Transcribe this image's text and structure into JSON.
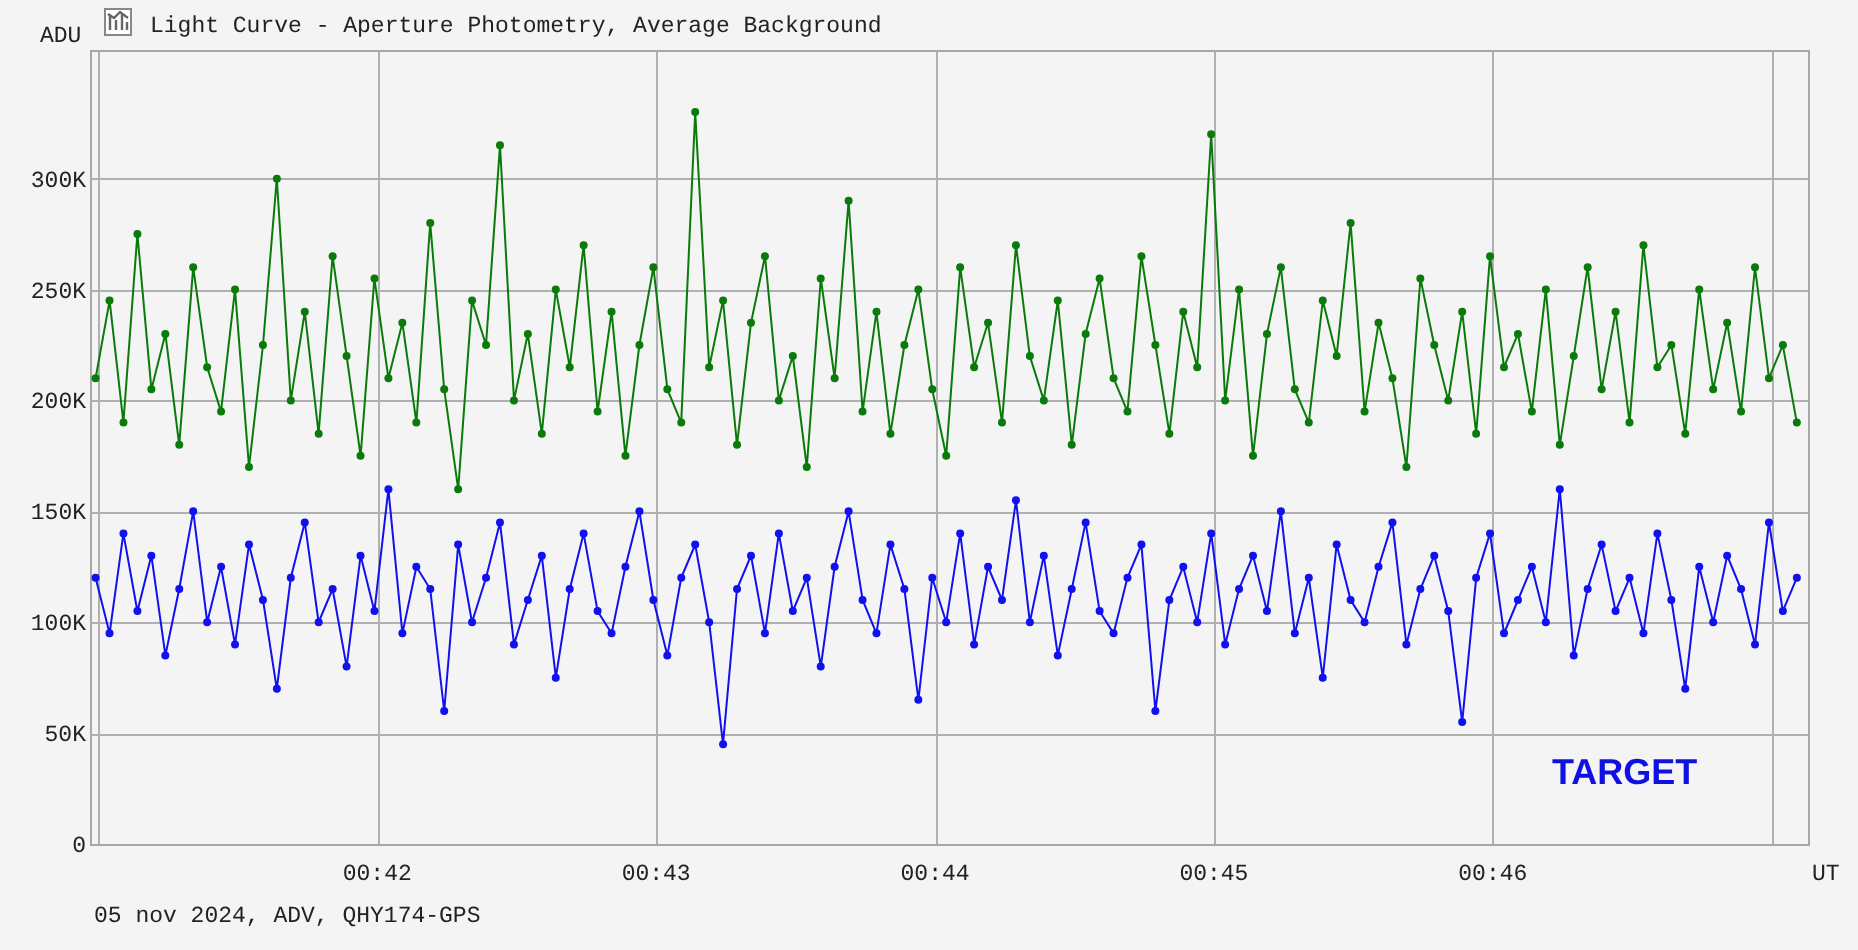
{
  "title": "Light Curve - Aperture Photometry, Average Background",
  "chart_data": {
    "type": "line",
    "ylabel": "ADU",
    "xlabel": "UT",
    "grid": true,
    "xlim": [
      40.97,
      47.13
    ],
    "ylim": [
      0,
      358
    ],
    "x": [
      40.99,
      41.04,
      41.09,
      41.14,
      41.19,
      41.24,
      41.29,
      41.34,
      41.39,
      41.44,
      41.49,
      41.54,
      41.59,
      41.64,
      41.69,
      41.74,
      41.79,
      41.84,
      41.89,
      41.94,
      41.99,
      42.04,
      42.09,
      42.14,
      42.19,
      42.24,
      42.29,
      42.34,
      42.39,
      42.44,
      42.49,
      42.54,
      42.59,
      42.64,
      42.69,
      42.74,
      42.79,
      42.84,
      42.89,
      42.94,
      42.99,
      43.04,
      43.09,
      43.14,
      43.19,
      43.24,
      43.29,
      43.34,
      43.39,
      43.44,
      43.49,
      43.54,
      43.59,
      43.64,
      43.69,
      43.74,
      43.79,
      43.84,
      43.89,
      43.94,
      43.99,
      44.04,
      44.09,
      44.14,
      44.19,
      44.24,
      44.29,
      44.34,
      44.39,
      44.44,
      44.49,
      44.54,
      44.59,
      44.64,
      44.69,
      44.74,
      44.79,
      44.84,
      44.89,
      44.94,
      44.99,
      45.04,
      45.09,
      45.14,
      45.19,
      45.24,
      45.29,
      45.34,
      45.39,
      45.44,
      45.49,
      45.54,
      45.59,
      45.64,
      45.69,
      45.74,
      45.79,
      45.84,
      45.89,
      45.94,
      45.99,
      46.04,
      46.09,
      46.14,
      46.19,
      46.24,
      46.29,
      46.34,
      46.39,
      46.44,
      46.49,
      46.54,
      46.59,
      46.64,
      46.69,
      46.74,
      46.79,
      46.84,
      46.89,
      46.94,
      46.99,
      47.04,
      47.09
    ],
    "yticks": [
      {
        "value": 0,
        "label": "0"
      },
      {
        "value": 50,
        "label": "50K"
      },
      {
        "value": 100,
        "label": "100K"
      },
      {
        "value": 150,
        "label": "150K"
      },
      {
        "value": 200,
        "label": "200K"
      },
      {
        "value": 250,
        "label": "250K"
      },
      {
        "value": 300,
        "label": "300K"
      }
    ],
    "xticks": [
      {
        "value": 42,
        "label": "00:42"
      },
      {
        "value": 43,
        "label": "00:43"
      },
      {
        "value": 44,
        "label": "00:44"
      },
      {
        "value": 45,
        "label": "00:45"
      },
      {
        "value": 46,
        "label": "00:46"
      }
    ],
    "series": [
      {
        "color": "#0a7a0a",
        "marker": "circle",
        "values": [
          210,
          245,
          190,
          275,
          205,
          230,
          180,
          260,
          215,
          195,
          250,
          170,
          225,
          300,
          200,
          240,
          185,
          265,
          220,
          175,
          255,
          210,
          235,
          190,
          280,
          205,
          160,
          245,
          225,
          315,
          200,
          230,
          185,
          250,
          215,
          270,
          195,
          240,
          175,
          225,
          260,
          205,
          190,
          330,
          215,
          245,
          180,
          235,
          265,
          200,
          220,
          170,
          255,
          210,
          290,
          195,
          240,
          185,
          225,
          250,
          205,
          175,
          260,
          215,
          235,
          190,
          270,
          220,
          200,
          245,
          180,
          230,
          255,
          210,
          195,
          265,
          225,
          185,
          240,
          215,
          320,
          200,
          250,
          175,
          230,
          260,
          205,
          190,
          245,
          220,
          280,
          195,
          235,
          210,
          170,
          255,
          225,
          200,
          240,
          185,
          265,
          215,
          230,
          195,
          250,
          180,
          220,
          260,
          205,
          240,
          190,
          270,
          215,
          225,
          185,
          250,
          205,
          235,
          195,
          260,
          210,
          225,
          190
        ]
      },
      {
        "color": "#1010f0",
        "marker": "circle",
        "values": [
          120,
          95,
          140,
          105,
          130,
          85,
          115,
          150,
          100,
          125,
          90,
          135,
          110,
          70,
          120,
          145,
          100,
          115,
          80,
          130,
          105,
          160,
          95,
          125,
          115,
          60,
          135,
          100,
          120,
          145,
          90,
          110,
          130,
          75,
          115,
          140,
          105,
          95,
          125,
          150,
          110,
          85,
          120,
          135,
          100,
          45,
          115,
          130,
          95,
          140,
          105,
          120,
          80,
          125,
          150,
          110,
          95,
          135,
          115,
          65,
          120,
          100,
          140,
          90,
          125,
          110,
          155,
          100,
          130,
          85,
          115,
          145,
          105,
          95,
          120,
          135,
          60,
          110,
          125,
          100,
          140,
          90,
          115,
          130,
          105,
          150,
          95,
          120,
          75,
          135,
          110,
          100,
          125,
          145,
          90,
          115,
          130,
          105,
          55,
          120,
          140,
          95,
          110,
          125,
          100,
          160,
          85,
          115,
          135,
          105,
          120,
          95,
          140,
          110,
          70,
          125,
          100,
          130,
          115,
          90,
          145,
          105,
          120
        ]
      }
    ],
    "annotations": [
      {
        "text": "TARGET"
      }
    ]
  },
  "footer": "05 nov 2024, ADV, QHY174-GPS"
}
